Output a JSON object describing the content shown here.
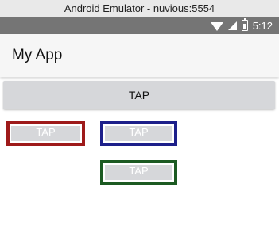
{
  "window": {
    "title": "Android Emulator - nuvious:5554"
  },
  "status_bar": {
    "time": "5:12"
  },
  "app_bar": {
    "title": "My App"
  },
  "buttons": {
    "top": "TAP",
    "left": "TAP",
    "center": "TAP",
    "bottom": "TAP"
  },
  "colors": {
    "left_border": "#9e1a1a",
    "center_border": "#1d1f8a",
    "bottom_border": "#1c5a22",
    "button_fill": "#d6d7da",
    "status_bar": "#757575"
  },
  "icons": [
    "wifi-icon",
    "signal-icon",
    "battery-icon"
  ]
}
